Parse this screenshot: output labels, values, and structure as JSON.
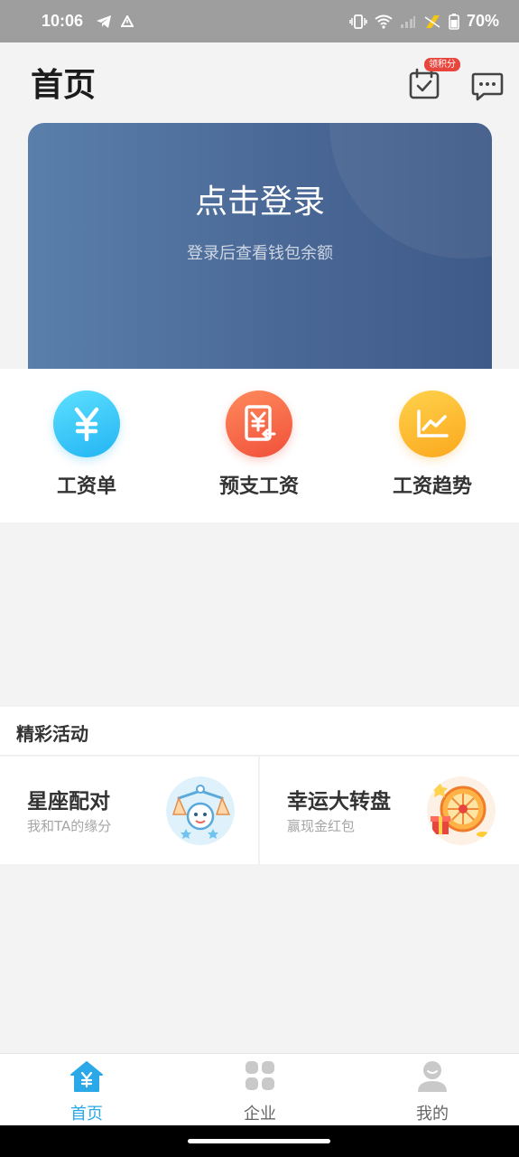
{
  "status_bar": {
    "time": "10:06",
    "battery": "70%"
  },
  "header": {
    "title": "首页",
    "points_badge": "领积分"
  },
  "login_card": {
    "title": "点击登录",
    "subtitle": "登录后查看钱包余额"
  },
  "features": [
    {
      "label": "工资单",
      "icon": "yuan-icon",
      "color": "#22b4f3"
    },
    {
      "label": "预支工资",
      "icon": "advance-pay-icon",
      "color": "#f0503a"
    },
    {
      "label": "工资趋势",
      "icon": "trend-chart-icon",
      "color": "#fba81d"
    }
  ],
  "activities": {
    "title": "精彩活动",
    "items": [
      {
        "title": "星座配对",
        "subtitle": "我和TA的缘分",
        "icon": "zodiac-libra-icon"
      },
      {
        "title": "幸运大转盘",
        "subtitle": "赢现金红包",
        "icon": "lucky-wheel-icon"
      }
    ]
  },
  "bottom_nav": [
    {
      "label": "首页",
      "icon": "home-icon",
      "active": true
    },
    {
      "label": "企业",
      "icon": "enterprise-grid-icon",
      "active": false
    },
    {
      "label": "我的",
      "icon": "profile-icon",
      "active": false
    }
  ],
  "colors": {
    "accent": "#2aa8e8",
    "card": "#4a6896"
  }
}
